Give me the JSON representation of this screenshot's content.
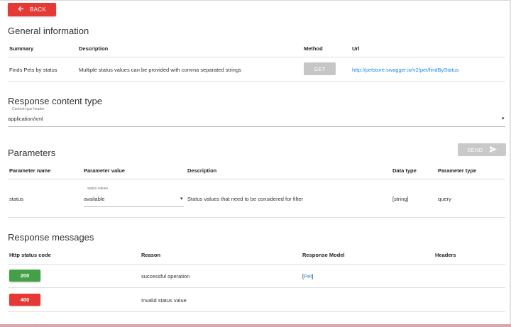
{
  "header": {
    "back_label": "BACK"
  },
  "general": {
    "title": "General information",
    "columns": {
      "summary": "Summary",
      "description": "Description",
      "method": "Method",
      "url": "Url"
    },
    "row": {
      "summary": "Finds Pets by status",
      "description": "Multiple status values can be provided with comma separated strings",
      "method": "GET",
      "url": "http://petstore.swagger.io/v2/pet/findByStatus"
    }
  },
  "response_content": {
    "title": "Response content type",
    "field_label": "Content-type header",
    "value": "application/xml",
    "caret": "▾"
  },
  "parameters": {
    "title": "Parameters",
    "send_label": "SEND",
    "columns": {
      "name": "Parameter name",
      "value": "Parameter value",
      "description": "Description",
      "data_type": "Data type",
      "param_type": "Parameter type"
    },
    "row": {
      "name": "status",
      "value_label": "status values",
      "value": "available",
      "caret": "▾",
      "description": "Status values that need to be considered for filter",
      "data_type": "[string]",
      "param_type": "query"
    }
  },
  "responses": {
    "title": "Response messages",
    "columns": {
      "code": "Http status code",
      "reason": "Reason",
      "model": "Response Model",
      "headers": "Headers"
    },
    "rows": [
      {
        "code": "200",
        "reason": "successful operation",
        "model_open": "[",
        "model": "Pet",
        "model_close": "]",
        "color": "#43a047"
      },
      {
        "code": "400",
        "reason": "Invalid status value",
        "color": "#e53935"
      }
    ]
  }
}
